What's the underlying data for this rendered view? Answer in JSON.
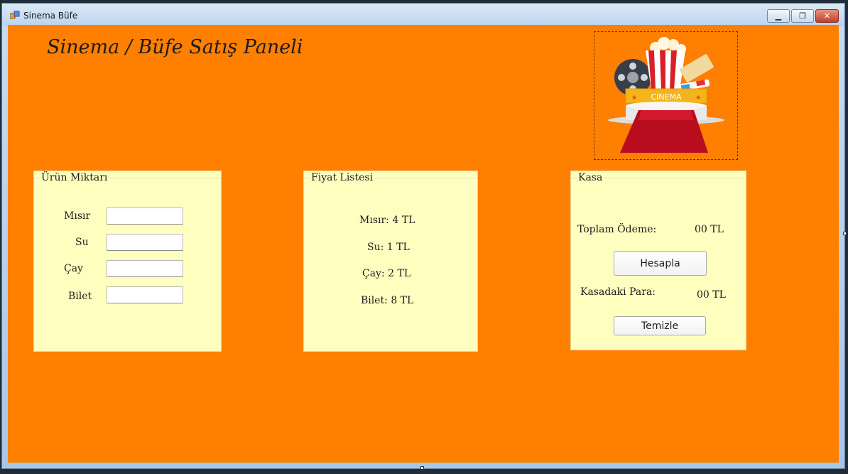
{
  "window": {
    "title": "Sinema Büfe"
  },
  "header": {
    "title": "Sinema / Büfe Satış Paneli"
  },
  "logo": {
    "text": "CINEMA"
  },
  "urun_miktari": {
    "title": "Ürün Miktarı",
    "labels": [
      "Mısır",
      "Su",
      "Çay",
      "Bilet"
    ],
    "values": [
      "",
      "",
      "",
      ""
    ]
  },
  "fiyat_listesi": {
    "title": "Fiyat Listesi",
    "items": [
      "Mısır: 4 TL",
      "Su: 1 TL",
      "Çay: 2 TL",
      "Bilet: 8 TL"
    ]
  },
  "kasa": {
    "title": "Kasa",
    "toplam_label": "Toplam Ödeme:",
    "toplam_value": "00 TL",
    "hesapla_label": "Hesapla",
    "kasadaki_label": "Kasadaki Para:",
    "kasadaki_value": "00 TL",
    "temizle_label": "Temizle"
  },
  "colors": {
    "background": "#ff7f00",
    "panel": "#ffffc0"
  }
}
